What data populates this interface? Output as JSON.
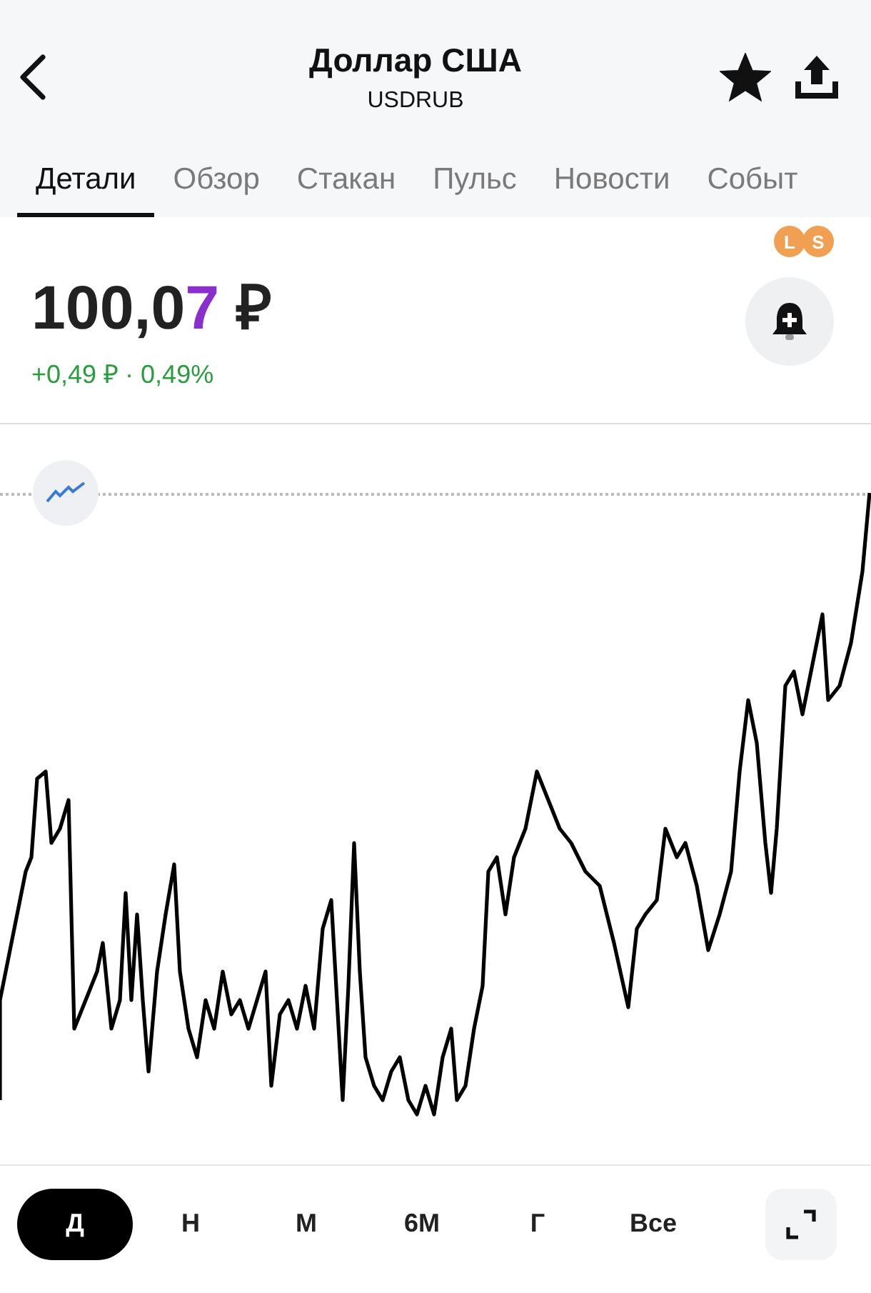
{
  "header": {
    "title": "Доллар США",
    "subtitle": "USDRUB",
    "favorite": true
  },
  "tabs": [
    {
      "label": "Детали",
      "selected": true
    },
    {
      "label": "Обзор",
      "selected": false
    },
    {
      "label": "Стакан",
      "selected": false
    },
    {
      "label": "Пульс",
      "selected": false
    },
    {
      "label": "Новости",
      "selected": false
    },
    {
      "label": "Событ",
      "selected": false
    }
  ],
  "quote": {
    "price_main": "100,0",
    "price_last_digit": "7",
    "currency": "₽",
    "change": "+0,49 ₽ · 0,49%",
    "badges": [
      "L",
      "S"
    ]
  },
  "periods": [
    {
      "label": "Д",
      "selected": true
    },
    {
      "label": "Н",
      "selected": false
    },
    {
      "label": "М",
      "selected": false
    },
    {
      "label": "6М",
      "selected": false
    },
    {
      "label": "Г",
      "selected": false
    },
    {
      "label": "Все",
      "selected": false
    }
  ]
}
